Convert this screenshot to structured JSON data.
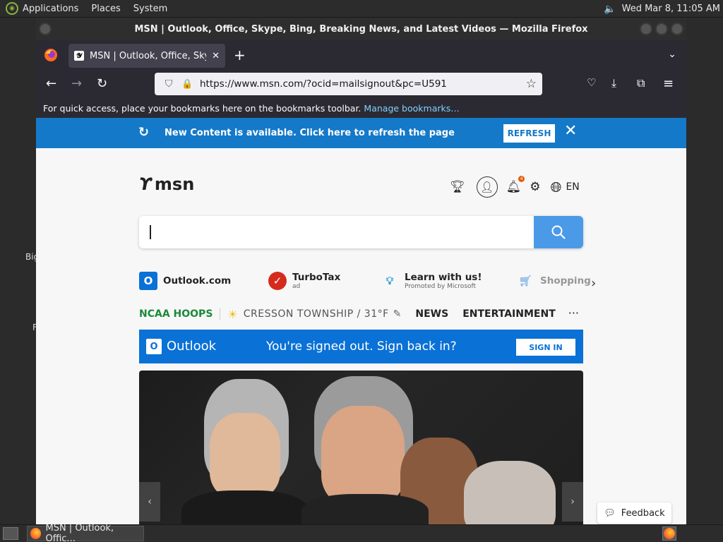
{
  "topbar": {
    "menus": [
      "Applications",
      "Places",
      "System"
    ],
    "clock": "Wed Mar  8, 11:05 AM"
  },
  "desktop": {
    "text1": "Big",
    "text2": "F"
  },
  "window": {
    "title": "MSN | Outlook, Office, Skype, Bing, Breaking News, and Latest Videos — Mozilla Firefox"
  },
  "tab": {
    "title": "MSN | Outlook, Office, Skype"
  },
  "url": {
    "value": "https://www.msn.com/?ocid=mailsignout&pc=U591"
  },
  "bookmarks": {
    "text": "For quick access, place your bookmarks here on the bookmarks toolbar.",
    "link": "Manage bookmarks…"
  },
  "banner": {
    "text": "New Content is available. Click here to refresh the page",
    "refresh": "REFRESH"
  },
  "msn": {
    "logo": "msn",
    "lang": "EN",
    "badge": "4"
  },
  "quicklinks": [
    {
      "title": "Outlook.com",
      "sub": ""
    },
    {
      "title": "TurboTax",
      "sub": "ad"
    },
    {
      "title": "Learn with us!",
      "sub": "Promoted by Microsoft"
    },
    {
      "title": "Shopping",
      "sub": ""
    }
  ],
  "navrow": {
    "ncaa": "NCAA HOOPS",
    "location": "CRESSON TOWNSHIP / 31°F",
    "news": "NEWS",
    "entertainment": "ENTERTAINMENT"
  },
  "outlook": {
    "name": "Outlook",
    "message": "You're signed out. Sign back in?",
    "signin": "SIGN IN"
  },
  "feedback": {
    "label": "Feedback"
  },
  "taskbar": {
    "window": "MSN | Outlook, Offic..."
  },
  "colors": {
    "banner": "#1479c8",
    "outlook": "#0a71d6",
    "ncaa": "#1a8a3a",
    "search_button": "#4b9ae8"
  }
}
